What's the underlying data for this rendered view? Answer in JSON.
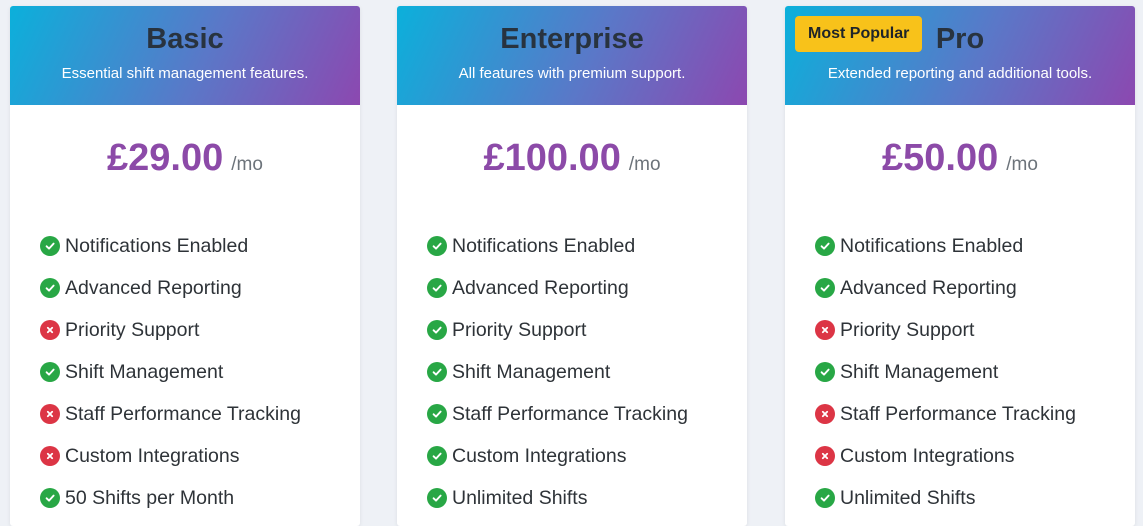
{
  "plans": [
    {
      "name": "Basic",
      "description": "Essential shift management features.",
      "price": "£29.00",
      "period": "/mo",
      "badge": "",
      "features": [
        {
          "label": "Notifications Enabled",
          "included": true
        },
        {
          "label": "Advanced Reporting",
          "included": true
        },
        {
          "label": "Priority Support",
          "included": false
        },
        {
          "label": "Shift Management",
          "included": true
        },
        {
          "label": "Staff Performance Tracking",
          "included": false
        },
        {
          "label": "Custom Integrations",
          "included": false
        },
        {
          "label": "50 Shifts per Month",
          "included": true
        }
      ]
    },
    {
      "name": "Enterprise",
      "description": "All features with premium support.",
      "price": "£100.00",
      "period": "/mo",
      "badge": "",
      "features": [
        {
          "label": "Notifications Enabled",
          "included": true
        },
        {
          "label": "Advanced Reporting",
          "included": true
        },
        {
          "label": "Priority Support",
          "included": true
        },
        {
          "label": "Shift Management",
          "included": true
        },
        {
          "label": "Staff Performance Tracking",
          "included": true
        },
        {
          "label": "Custom Integrations",
          "included": true
        },
        {
          "label": "Unlimited Shifts",
          "included": true
        }
      ]
    },
    {
      "name": "Pro",
      "description": "Extended reporting and additional tools.",
      "price": "£50.00",
      "period": "/mo",
      "badge": "Most Popular",
      "features": [
        {
          "label": "Notifications Enabled",
          "included": true
        },
        {
          "label": "Advanced Reporting",
          "included": true
        },
        {
          "label": "Priority Support",
          "included": false
        },
        {
          "label": "Shift Management",
          "included": true
        },
        {
          "label": "Staff Performance Tracking",
          "included": false
        },
        {
          "label": "Custom Integrations",
          "included": false
        },
        {
          "label": "Unlimited Shifts",
          "included": true
        }
      ]
    }
  ],
  "colors": {
    "header_gradient": [
      "#0bb0db",
      "#5a78c8",
      "#8c48b0"
    ],
    "price": "#8c4aa8",
    "included": "#28a745",
    "excluded": "#dc3545",
    "badge": "#f8c21a"
  },
  "icons": {
    "included": "check-circle-icon",
    "excluded": "x-circle-icon"
  }
}
